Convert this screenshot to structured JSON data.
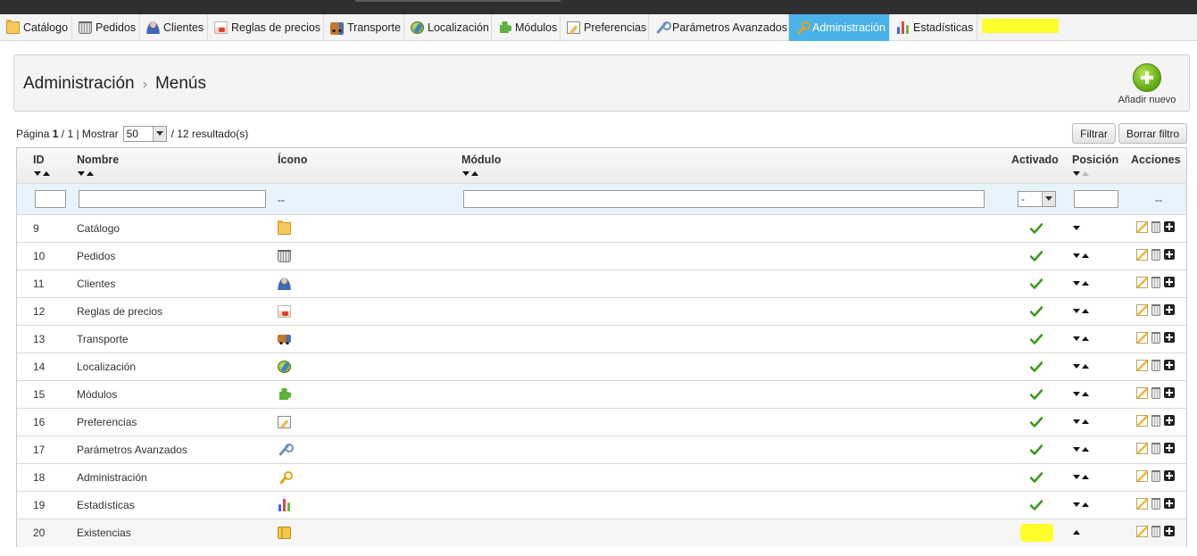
{
  "tabs": [
    {
      "label": "Catálogo",
      "icon": "folder-icon"
    },
    {
      "label": "Pedidos",
      "icon": "cart-icon"
    },
    {
      "label": "Clientes",
      "icon": "user-icon"
    },
    {
      "label": "Reglas de precios",
      "icon": "price-rules-icon"
    },
    {
      "label": "Transporte",
      "icon": "truck-icon"
    },
    {
      "label": "Localización",
      "icon": "globe-icon"
    },
    {
      "label": "Módulos",
      "icon": "puzzle-icon"
    },
    {
      "label": "Preferencias",
      "icon": "preferences-icon"
    },
    {
      "label": "Parámetros Avanzados",
      "icon": "wrench-icon"
    },
    {
      "label": "Administración",
      "icon": "key-icon",
      "active": true
    },
    {
      "label": "Estadísticas",
      "icon": "stats-icon"
    }
  ],
  "header": {
    "crumb_parent": "Administración",
    "crumb_sep": "›",
    "crumb_current": "Menús",
    "add_new": "Añadir nuevo"
  },
  "pagination": {
    "page_label": "Página",
    "page_current": "1",
    "page_sep": "/",
    "page_total": "1",
    "show_label": "| Mostrar",
    "per_page": "50",
    "results": "/ 12 resultado(s)"
  },
  "buttons": {
    "filter": "Filtrar",
    "clear_filter": "Borrar filtro"
  },
  "table": {
    "columns": {
      "id": "ID",
      "name": "Nombre",
      "icon": "Ícono",
      "module": "Módulo",
      "active": "Activado",
      "position": "Posición",
      "actions": "Acciones"
    },
    "filter": {
      "icon_placeholder": "--",
      "active_select": "-",
      "actions_placeholder": "--"
    },
    "rows": [
      {
        "id": "9",
        "name": "Catálogo",
        "icon": "folder-icon",
        "module": "",
        "active": true,
        "pos": "down"
      },
      {
        "id": "10",
        "name": "Pedidos",
        "icon": "cart-icon",
        "module": "",
        "active": true,
        "pos": "both"
      },
      {
        "id": "11",
        "name": "Clientes",
        "icon": "user-icon",
        "module": "",
        "active": true,
        "pos": "both"
      },
      {
        "id": "12",
        "name": "Reglas de precios",
        "icon": "price-rules-icon",
        "module": "",
        "active": true,
        "pos": "both"
      },
      {
        "id": "13",
        "name": "Transporte",
        "icon": "truck-icon",
        "module": "",
        "active": true,
        "pos": "both"
      },
      {
        "id": "14",
        "name": "Localización",
        "icon": "globe-icon",
        "module": "",
        "active": true,
        "pos": "both"
      },
      {
        "id": "15",
        "name": "Módulos",
        "icon": "puzzle-icon",
        "module": "",
        "active": true,
        "pos": "both"
      },
      {
        "id": "16",
        "name": "Preferencias",
        "icon": "preferences-icon",
        "module": "",
        "active": true,
        "pos": "both"
      },
      {
        "id": "17",
        "name": "Parámetros Avanzados",
        "icon": "wrench-icon",
        "module": "",
        "active": true,
        "pos": "both"
      },
      {
        "id": "18",
        "name": "Administración",
        "icon": "key-icon",
        "module": "",
        "active": true,
        "pos": "both"
      },
      {
        "id": "19",
        "name": "Estadísticas",
        "icon": "stats-icon",
        "module": "",
        "active": true,
        "pos": "both"
      },
      {
        "id": "20",
        "name": "Existencias",
        "icon": "stock-icon",
        "module": "",
        "active": true,
        "pos": "up"
      }
    ]
  },
  "colors": {
    "accent_tab": "#49b2e9",
    "highlight": "#ffff2a",
    "check_green": "#3c9a1e",
    "filter_row": "#e8f3fb"
  }
}
